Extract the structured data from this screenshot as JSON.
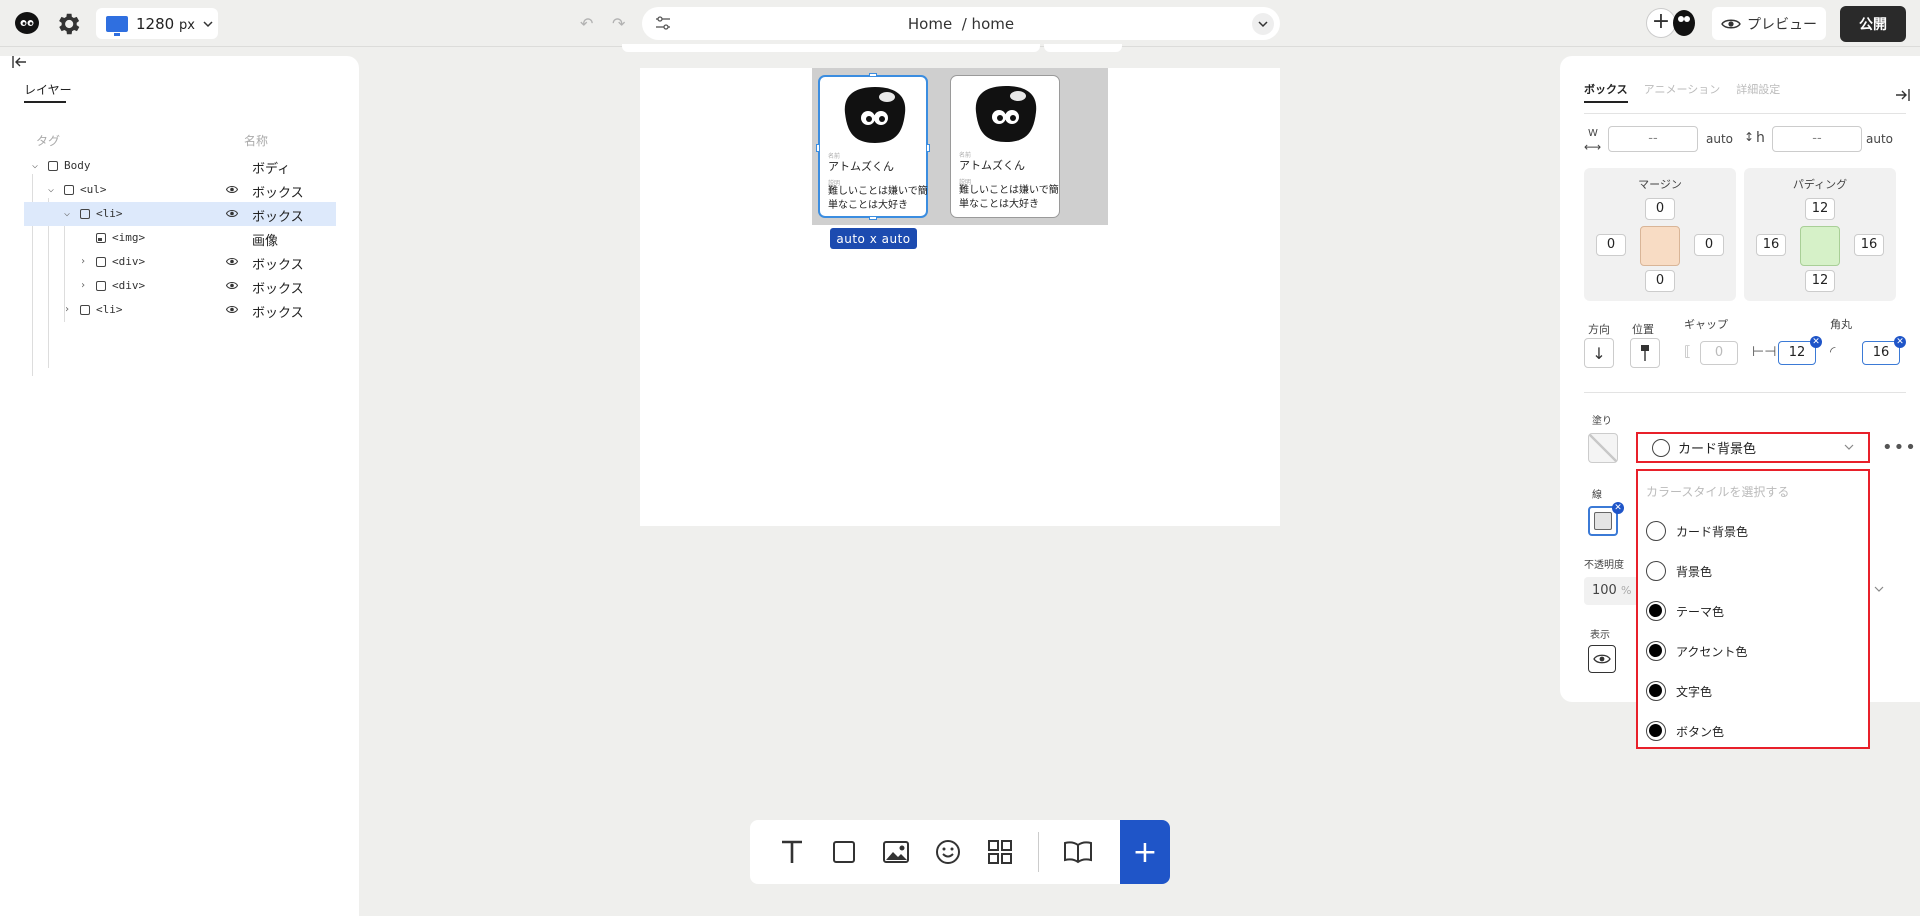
{
  "topbar": {
    "device_value": "1280",
    "device_unit": "px",
    "page_name": "Home",
    "page_path": "/ home",
    "preview_label": "プレビュー",
    "publish_label": "公開"
  },
  "layers": {
    "tab_label": "レイヤー",
    "col_tag": "タグ",
    "col_name": "名称",
    "rows": [
      {
        "tag": "Body",
        "name": "ボディ"
      },
      {
        "tag": "<ul>",
        "name": "ボックス"
      },
      {
        "tag": "<li>",
        "name": "ボックス"
      },
      {
        "tag": "<img>",
        "name": "画像"
      },
      {
        "tag": "<div>",
        "name": "ボックス"
      },
      {
        "tag": "<div>",
        "name": "ボックス"
      },
      {
        "tag": "<li>",
        "name": "ボックス"
      }
    ]
  },
  "canvas": {
    "cards": [
      {
        "name_label": "名前",
        "name": "アトムズくん",
        "desc_label": "説明",
        "desc": "難しいことは嫌いで簡単なことは大好き"
      },
      {
        "name_label": "名前",
        "name": "アトムズくん",
        "desc_label": "説明",
        "desc": "難しいことは嫌いで簡単なことは大好き"
      }
    ],
    "size_badge": "auto x auto"
  },
  "props": {
    "tabs": [
      "ボックス",
      "アニメーション",
      "詳細設定"
    ],
    "width_label": "W",
    "height_label": "h",
    "width_value": "-- ",
    "height_value": "-- ",
    "auto_label": "auto",
    "margin": {
      "title": "マージン",
      "top": "0",
      "left": "0",
      "right": "0",
      "bottom": "0",
      "color": "#f8dcc4"
    },
    "padding": {
      "title": "パディング",
      "top": "12",
      "left": "16",
      "right": "16",
      "bottom": "12",
      "color": "#d6f1c8"
    },
    "direction_label": "方向",
    "position_label": "位置",
    "gap_label": "ギャップ",
    "gap_row": "0",
    "gap_col": "12",
    "radius_label": "角丸",
    "radius_value": "16",
    "fill_label": "塗り",
    "fill_selected": "カード背景色",
    "stroke_label": "線",
    "opacity_label": "不透明度",
    "opacity_value": "100",
    "opacity_unit": "%",
    "visibility_label": "表示"
  },
  "dropdown": {
    "placeholder": "カラースタイルを選択する",
    "options": [
      {
        "label": "カード背景色",
        "dark": false
      },
      {
        "label": "背景色",
        "dark": false
      },
      {
        "label": "テーマ色",
        "dark": true
      },
      {
        "label": "アクセント色",
        "dark": true
      },
      {
        "label": "文字色",
        "dark": true
      },
      {
        "label": "ボタン色",
        "dark": true
      }
    ]
  },
  "colors": {
    "accent_blue": "#1f55c8",
    "highlight_red": "#e8202a",
    "selection_bg": "#dde9fb"
  }
}
